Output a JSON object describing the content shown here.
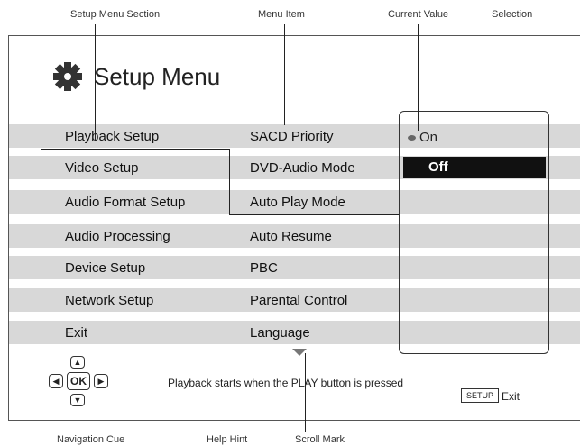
{
  "callouts": {
    "setup_menu_section": "Setup Menu Section",
    "menu_item": "Menu Item",
    "current_value": "Current Value",
    "selection": "Selection",
    "navigation_cue": "Navigation Cue",
    "help_hint": "Help Hint",
    "scroll_mark": "Scroll Mark"
  },
  "menu": {
    "title": "Setup Menu",
    "sections": [
      "Playback Setup",
      "Video Setup",
      "Audio Format Setup",
      "Audio Processing",
      "Device Setup",
      "Network Setup",
      "Exit"
    ],
    "items": [
      "SACD Priority",
      "DVD-Audio Mode",
      "Auto Play Mode",
      "Auto Resume",
      "PBC",
      "Parental Control",
      "Language"
    ],
    "current_value": "On",
    "selected_value": "Off"
  },
  "footer": {
    "help_hint": "Playback starts when the PLAY button is pressed",
    "setup_key": "SETUP",
    "exit_label": "Exit",
    "ok_key": "OK"
  },
  "icons": {
    "menu": "gear-icon",
    "nav_up": "arrow-up-icon",
    "nav_down": "arrow-down-icon",
    "nav_left": "arrow-left-icon",
    "nav_right": "arrow-right-icon",
    "scroll": "scroll-down-icon",
    "current_value_marker": "dot-icon"
  },
  "colors": {
    "row_background": "#d8d8d8",
    "selection_background": "#111111",
    "selection_text": "#ffffff"
  }
}
